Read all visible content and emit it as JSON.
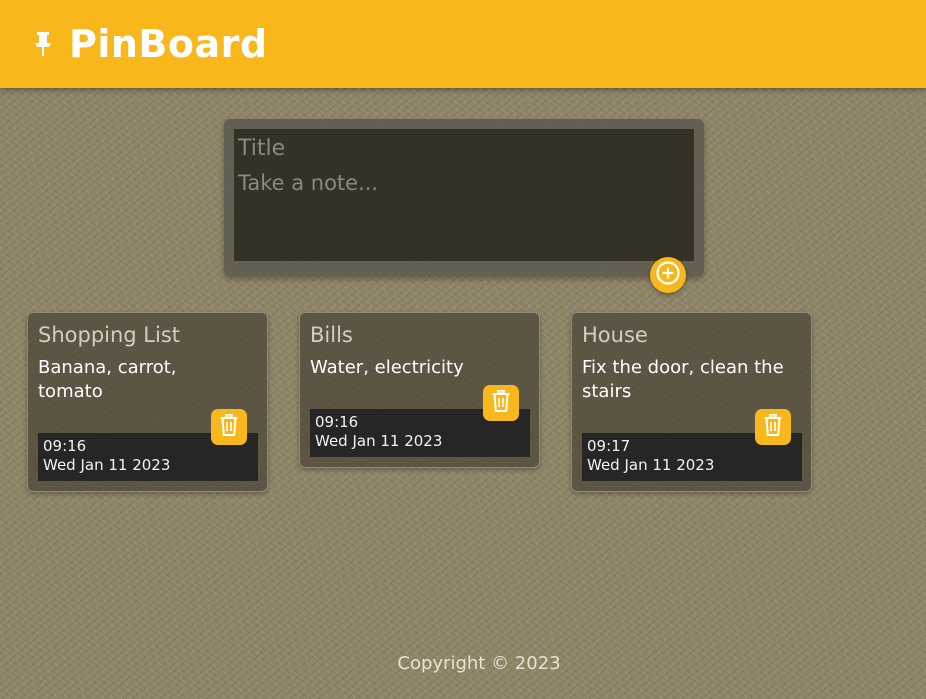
{
  "app": {
    "title": "PinBoard",
    "icons": {
      "logo": "pushpin-icon",
      "add": "plus-circle-icon",
      "delete": "trash-icon"
    },
    "colors": {
      "accent": "#f8b81b",
      "note_meta_bg": "#262626",
      "text_light": "#ffffff"
    }
  },
  "composer": {
    "title_placeholder": "Title",
    "body_placeholder": "Take a note..."
  },
  "notes": [
    {
      "title": "Shopping List",
      "body": "Banana, carrot, tomato",
      "time": "09:16",
      "date": "Wed Jan 11 2023"
    },
    {
      "title": "Bills",
      "body": "Water, electricity",
      "time": "09:16",
      "date": "Wed Jan 11 2023"
    },
    {
      "title": "House",
      "body": "Fix the door, clean the stairs",
      "time": "09:17",
      "date": "Wed Jan 11 2023"
    }
  ],
  "footer": {
    "copyright": "Copyright © 2023"
  }
}
